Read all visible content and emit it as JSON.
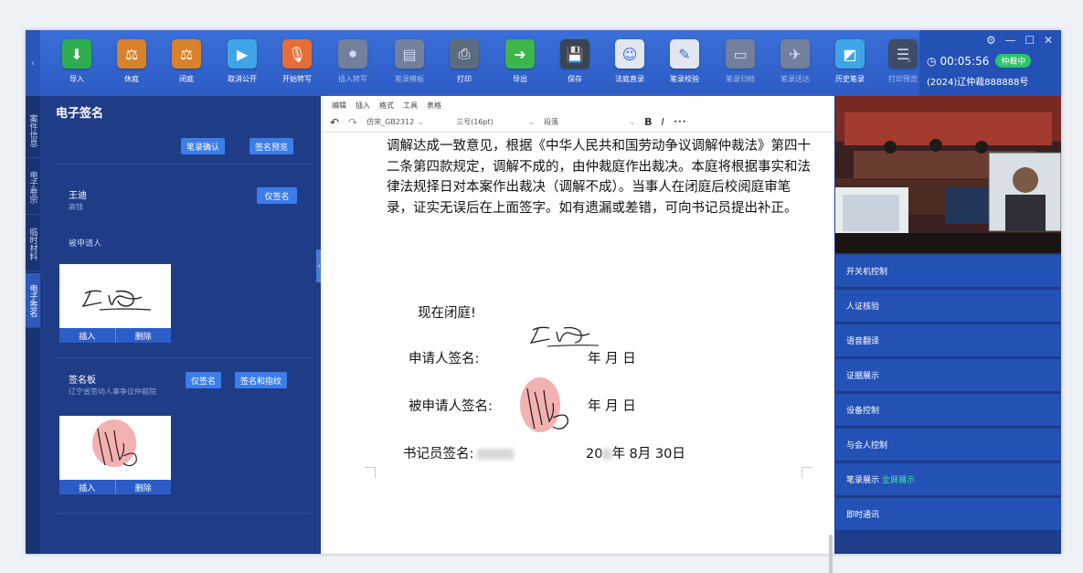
{
  "toolbar": {
    "collapse_glyph": "‹",
    "items": [
      {
        "label": "导入",
        "icon": "download-icon",
        "color": "#2fae4f",
        "glyph": "⬇",
        "enabled": true
      },
      {
        "label": "休庭",
        "icon": "pause-hammer-icon",
        "color": "#d9822b",
        "glyph": "⚖",
        "enabled": true
      },
      {
        "label": "闭庭",
        "icon": "close-court-icon",
        "color": "#d9822b",
        "glyph": "⚖",
        "enabled": true
      },
      {
        "label": "取消公开",
        "icon": "broadcast-icon",
        "color": "#3fa5e8",
        "glyph": "▶",
        "enabled": true
      },
      {
        "label": "开始转写",
        "icon": "microphone-icon",
        "color": "#e86d35",
        "glyph": "🎙",
        "enabled": true
      },
      {
        "label": "插入转写",
        "icon": "insert-transcript-icon",
        "color": "#7a8aa8",
        "glyph": "⏺",
        "enabled": false
      },
      {
        "label": "笔录模板",
        "icon": "template-icon",
        "color": "#7a8aa8",
        "glyph": "▤",
        "enabled": false
      },
      {
        "label": "打印",
        "icon": "printer-icon",
        "color": "#5d6b80",
        "glyph": "⎙",
        "enabled": true
      },
      {
        "label": "导出",
        "icon": "export-icon",
        "color": "#3cb54a",
        "glyph": "➜",
        "enabled": true
      },
      {
        "label": "保存",
        "icon": "save-icon",
        "color": "#3a4452",
        "glyph": "💾",
        "enabled": true
      },
      {
        "label": "法庭直录",
        "icon": "person-record-icon",
        "color": "#e2e6ee",
        "glyph": "☺",
        "enabled": true
      },
      {
        "label": "笔录校验",
        "icon": "edit-check-icon",
        "color": "#e2e6ee",
        "glyph": "✎",
        "enabled": true
      },
      {
        "label": "笔录归档",
        "icon": "archive-icon",
        "color": "#7a8aa8",
        "glyph": "▭",
        "enabled": false
      },
      {
        "label": "笔录送达",
        "icon": "send-icon",
        "color": "#7a8aa8",
        "glyph": "✈",
        "enabled": false
      },
      {
        "label": "历史笔录",
        "icon": "history-icon",
        "color": "#3fa5e8",
        "glyph": "◩",
        "enabled": true
      },
      {
        "label": "打印预览",
        "icon": "print-preview-icon",
        "color": "#3a4452",
        "glyph": "☰",
        "enabled": false
      }
    ],
    "more_glyph": "›"
  },
  "status": {
    "window_controls": "⚙ — ☐ ✕",
    "clock_glyph": "◷",
    "timer": "00:05:56",
    "badge": "仲裁中",
    "case_no": "(2024)辽仲裁888888号"
  },
  "vtabs": [
    "案件信息",
    "电子卷宗",
    "临时材料",
    "电子签名"
  ],
  "sign_panel": {
    "title": "电子签名",
    "confirm_btn": "笔录确认",
    "preview_btn": "签名预览",
    "signer1": {
      "name": "王迪",
      "sub": "高钱",
      "role": "被申请人",
      "sign_btn": "仅签名",
      "insert": "插入",
      "delete": "删除"
    },
    "signer2": {
      "name": "签名板",
      "org": "辽宁省劳动人事争议仲裁院",
      "sign_btn": "仅签名",
      "sign_fp_btn": "签名和指纹",
      "insert": "插入",
      "delete": "删除"
    }
  },
  "editor": {
    "menu": [
      "编辑",
      "插入",
      "格式",
      "工具",
      "表格"
    ],
    "undo": "↶",
    "redo": "↷",
    "font": "仿宋_GB2312",
    "size": "三号(16pt)",
    "para_style": "段落",
    "bold": "B",
    "italic": "I",
    "more": "•••",
    "paragraph": "调解达成一致意见，根据《中华人民共和国劳动争议调解仲裁法》第四十二条第四款规定，调解不成的，由仲裁庭作出裁决。本庭将根据事实和法律法规择日对本案作出裁决（调解不成）。当事人在闭庭后校阅庭审笔录，证实无误后在上面签字。如有遗漏或差错，可向书记员提出补正。",
    "closing": "现在闭庭!",
    "applicant_label": "申请人签名:",
    "respondent_label": "被申请人签名:",
    "clerk_label": "书记员签名:",
    "date_blank": "年   月   日",
    "date_year_prefix": "20",
    "date_rest": "年 8月 30日"
  },
  "right_panel": {
    "items": [
      {
        "label": "开关机控制"
      },
      {
        "label": "人证核验"
      },
      {
        "label": "语音翻译"
      },
      {
        "label": "证据展示"
      },
      {
        "label": "设备控制"
      },
      {
        "label": "与会人控制"
      },
      {
        "label": "笔录展示",
        "extra": "全屏展示"
      },
      {
        "label": "即时通讯"
      }
    ]
  }
}
